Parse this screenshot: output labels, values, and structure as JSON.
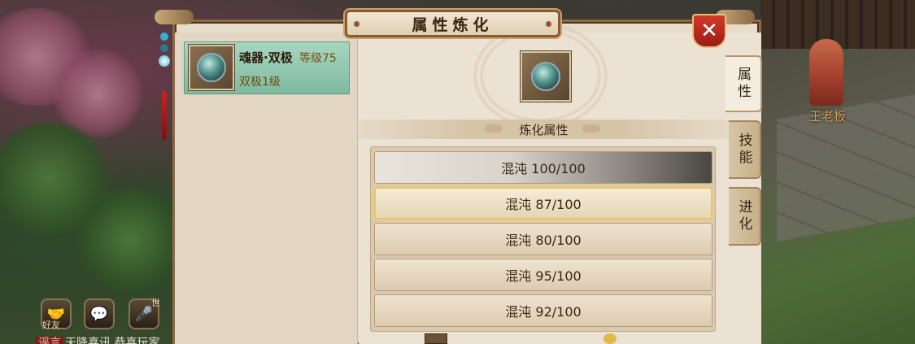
{
  "window": {
    "title": "属性炼化",
    "close_icon": "close-icon"
  },
  "item": {
    "name": "魂器·双极",
    "level_label": "等级75",
    "sub_label": "双极1级",
    "icon": "soul-orb-icon"
  },
  "refine_section": {
    "header": "炼化属性",
    "rows": [
      {
        "label": "混沌 100/100",
        "name": "混沌",
        "current": 100,
        "max": 100,
        "state": "maxed"
      },
      {
        "label": "混沌 87/100",
        "name": "混沌",
        "current": 87,
        "max": 100,
        "state": "selected"
      },
      {
        "label": "混沌 80/100",
        "name": "混沌",
        "current": 80,
        "max": 100,
        "state": "normal"
      },
      {
        "label": "混沌 95/100",
        "name": "混沌",
        "current": 95,
        "max": 100,
        "state": "normal"
      },
      {
        "label": "混沌 92/100",
        "name": "混沌",
        "current": 92,
        "max": 100,
        "state": "normal"
      }
    ]
  },
  "tabs": [
    {
      "label": "属性",
      "active": true
    },
    {
      "label": "技能",
      "active": false
    },
    {
      "label": "进化",
      "active": false
    }
  ],
  "scene": {
    "npc_name": "王老板"
  },
  "hud": {
    "friend_label": "好友",
    "voice_badge": "世",
    "chat_tag": "谣言",
    "chat_text": "天降喜讯 恭喜玩家"
  },
  "colors": {
    "panel_bg": "#e8dccb",
    "frame": "#8a6a45",
    "close_red": "#c22a1c",
    "selected_glow": "#e9c46a",
    "item_card": "#a7d6c0"
  }
}
